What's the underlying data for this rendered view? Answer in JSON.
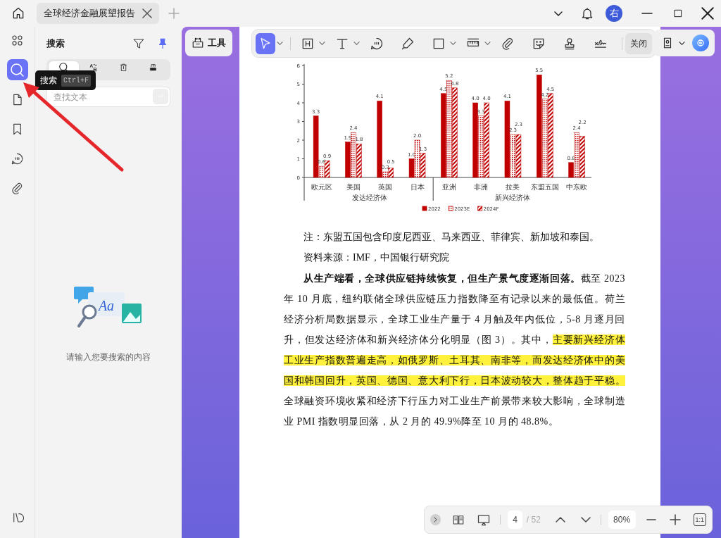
{
  "tab_bar": {
    "tabs": [
      {
        "title": "全球经济金融展望报告",
        "selected": true
      }
    ],
    "avatar": "右"
  },
  "nav_rail": {
    "items": [
      {
        "kind": "grid",
        "selected": false
      },
      {
        "kind": "search",
        "selected": true
      },
      {
        "kind": "page",
        "selected": false
      },
      {
        "kind": "bookmark",
        "selected": false
      },
      {
        "kind": "comment",
        "selected": false
      },
      {
        "kind": "attachment",
        "selected": false
      }
    ]
  },
  "tooltip": {
    "label": "搜索",
    "shortcut": "Ctrl+F"
  },
  "search_panel": {
    "title": "搜索",
    "pinned": true,
    "modes": [
      {
        "kind": "search",
        "selected": true
      },
      {
        "kind": "replace",
        "selected": false
      },
      {
        "kind": "delete",
        "selected": false
      },
      {
        "kind": "redact",
        "selected": false
      }
    ],
    "search_field": {
      "placeholder": "查找文本"
    },
    "illustration_text": "Aa",
    "empty_message": "请输入您要搜索的内容"
  },
  "toolbar": {
    "tools_button": "工具",
    "tools": [
      {
        "kind": "select",
        "selected": true,
        "dropdown": true
      },
      {
        "kind": "heading",
        "selected": false,
        "dropdown": true
      },
      {
        "kind": "text",
        "selected": false,
        "dropdown": true
      },
      {
        "kind": "comment",
        "selected": false,
        "dropdown": false
      },
      {
        "kind": "highlighter",
        "selected": false,
        "dropdown": false
      },
      {
        "kind": "rectangle",
        "selected": false,
        "dropdown": true
      },
      {
        "kind": "measure",
        "selected": false,
        "dropdown": true
      },
      {
        "kind": "attachment",
        "selected": false,
        "dropdown": false
      },
      {
        "kind": "sticker",
        "selected": false,
        "dropdown": false
      },
      {
        "kind": "stamp",
        "selected": false,
        "dropdown": false
      },
      {
        "kind": "signature",
        "selected": false,
        "dropdown": false
      }
    ],
    "close_button": "关闭"
  },
  "document": {
    "chart_data": {
      "type": "bar",
      "categories": [
        "欧元区",
        "美国",
        "英国",
        "日本",
        "亚洲",
        "非洲",
        "拉美",
        "东盟五国",
        "中东欧"
      ],
      "series": [
        {
          "name": "2022",
          "color": "#c00000",
          "values": [
            3.3,
            1.9,
            4.1,
            1.0,
            4.5,
            4.0,
            4.1,
            5.5,
            0.8
          ],
          "value_labels": [
            "3.3",
            "1.9",
            "4.1",
            "1.0",
            "4.5",
            "4.0",
            "4.1",
            "5.5",
            "0.8"
          ]
        },
        {
          "name": "2023E",
          "color": "#c00000",
          "values": [
            0.6,
            2.4,
            0.3,
            2.0,
            5.2,
            3.3,
            2.3,
            4.2,
            2.4
          ],
          "value_labels": [
            "0.6",
            "2.4",
            "0.3",
            "2.0",
            "5.2",
            "3.3",
            "2.3",
            "4.2",
            "2.4"
          ]
        },
        {
          "name": "2024F",
          "color": "#c00000",
          "values": [
            0.9,
            1.8,
            0.5,
            1.3,
            4.8,
            4.0,
            2.3,
            4.5,
            2.2
          ],
          "value_labels": [
            "0.9",
            "1.8",
            "0.5",
            "1.3",
            "4.8",
            "4.0",
            "2.3",
            "4.5",
            "2.2"
          ]
        }
      ],
      "ylim": [
        0,
        6
      ],
      "yticks": [
        0,
        1,
        2,
        3,
        4,
        5,
        6
      ],
      "legend": true
    },
    "chart_groups": [
      {
        "label": "发达经济体"
      },
      {
        "label": "新兴经济体"
      }
    ],
    "notes": [
      "注：东盟五国包含印度尼西亚、马来西亚、菲律宾、新加坡和泰国。",
      "资料来源：IMF，中国银行研究院"
    ],
    "paragraph": [
      {
        "text": "从生产端看，全球供应链持续恢复，但生产景气度逐渐回落。",
        "bold": true,
        "highlighted": false
      },
      {
        "text": "截至 2023 年 10 月底，纽约联储全球供应链压力指数降至有记录以来的最低值。荷兰经济分析局数据显示，全球工业生产量于 4 月触及年内低位，5-8 月逐月回升，但发达经济体和新兴经济体分化明显（图 3）。其中，",
        "bold": false,
        "highlighted": false
      },
      {
        "text": "主要新兴经济体工业生产指数普遍走高，如俄罗斯、土耳其、南非等，而发达经济体中的美国和韩国回升，英国、德国、意大利下行，日本波动较大，整体趋于平稳。",
        "bold": false,
        "highlighted": true
      },
      {
        "text": "全球融资环境收紧和经济下行压力对工业生产前景带来较大影响，全球制造业 PMI 指数明显回落，从 2 月的 49.9%降至 10 月的 48.8%。",
        "bold": false,
        "highlighted": false
      }
    ]
  },
  "page_nav": {
    "page": "4",
    "total": "/ 52",
    "zoom": "80%",
    "fit": "1:1"
  }
}
